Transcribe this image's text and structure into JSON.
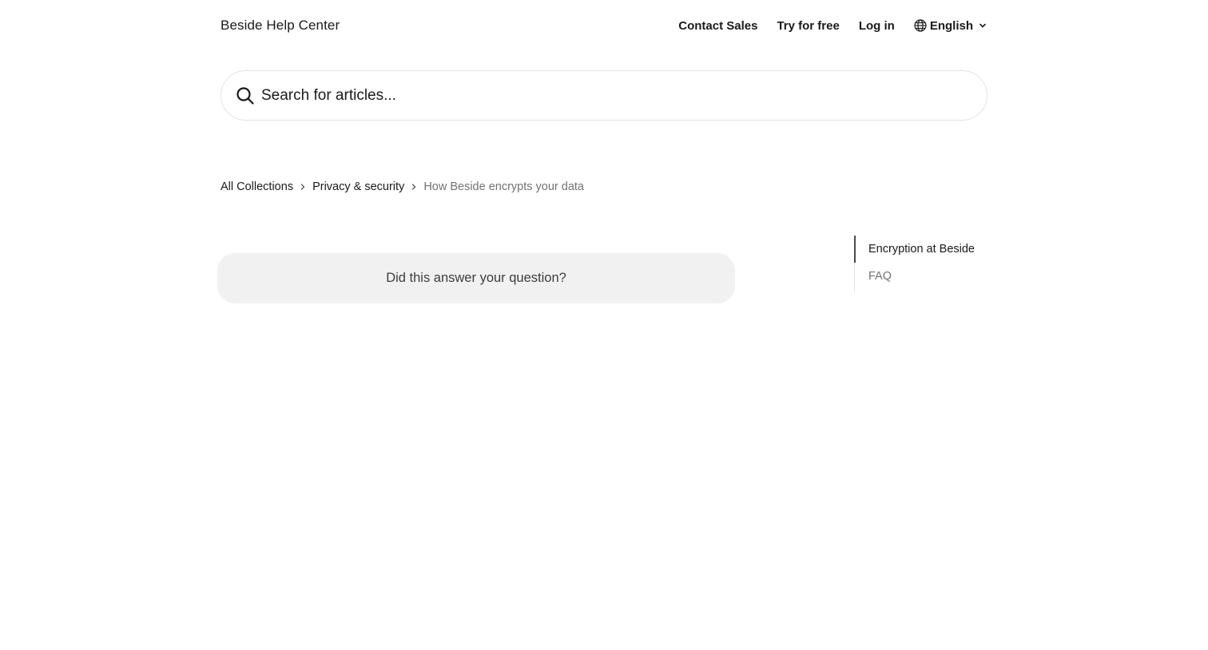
{
  "header": {
    "brand": "Beside Help Center",
    "nav": {
      "contact_sales": "Contact Sales",
      "try_free": "Try for free",
      "log_in": "Log in",
      "language": "English"
    }
  },
  "search": {
    "placeholder": "Search for articles...",
    "value": ""
  },
  "breadcrumb": {
    "items": [
      "All Collections",
      "Privacy & security",
      "How Beside encrypts your data"
    ]
  },
  "feedback": {
    "question": "Did this answer your question?"
  },
  "toc": {
    "items": [
      {
        "label": "Encryption at Beside",
        "active": true
      },
      {
        "label": "FAQ",
        "active": false
      }
    ]
  },
  "icons": {
    "search": "search-icon",
    "language": "globe-icon",
    "dropdown": "chevron-down-icon",
    "separator": "chevron-right-icon"
  },
  "colors": {
    "text": "#1a1a1a",
    "muted": "#737373",
    "card_bg": "#f1f1f1",
    "border": "#e3e3e3"
  }
}
